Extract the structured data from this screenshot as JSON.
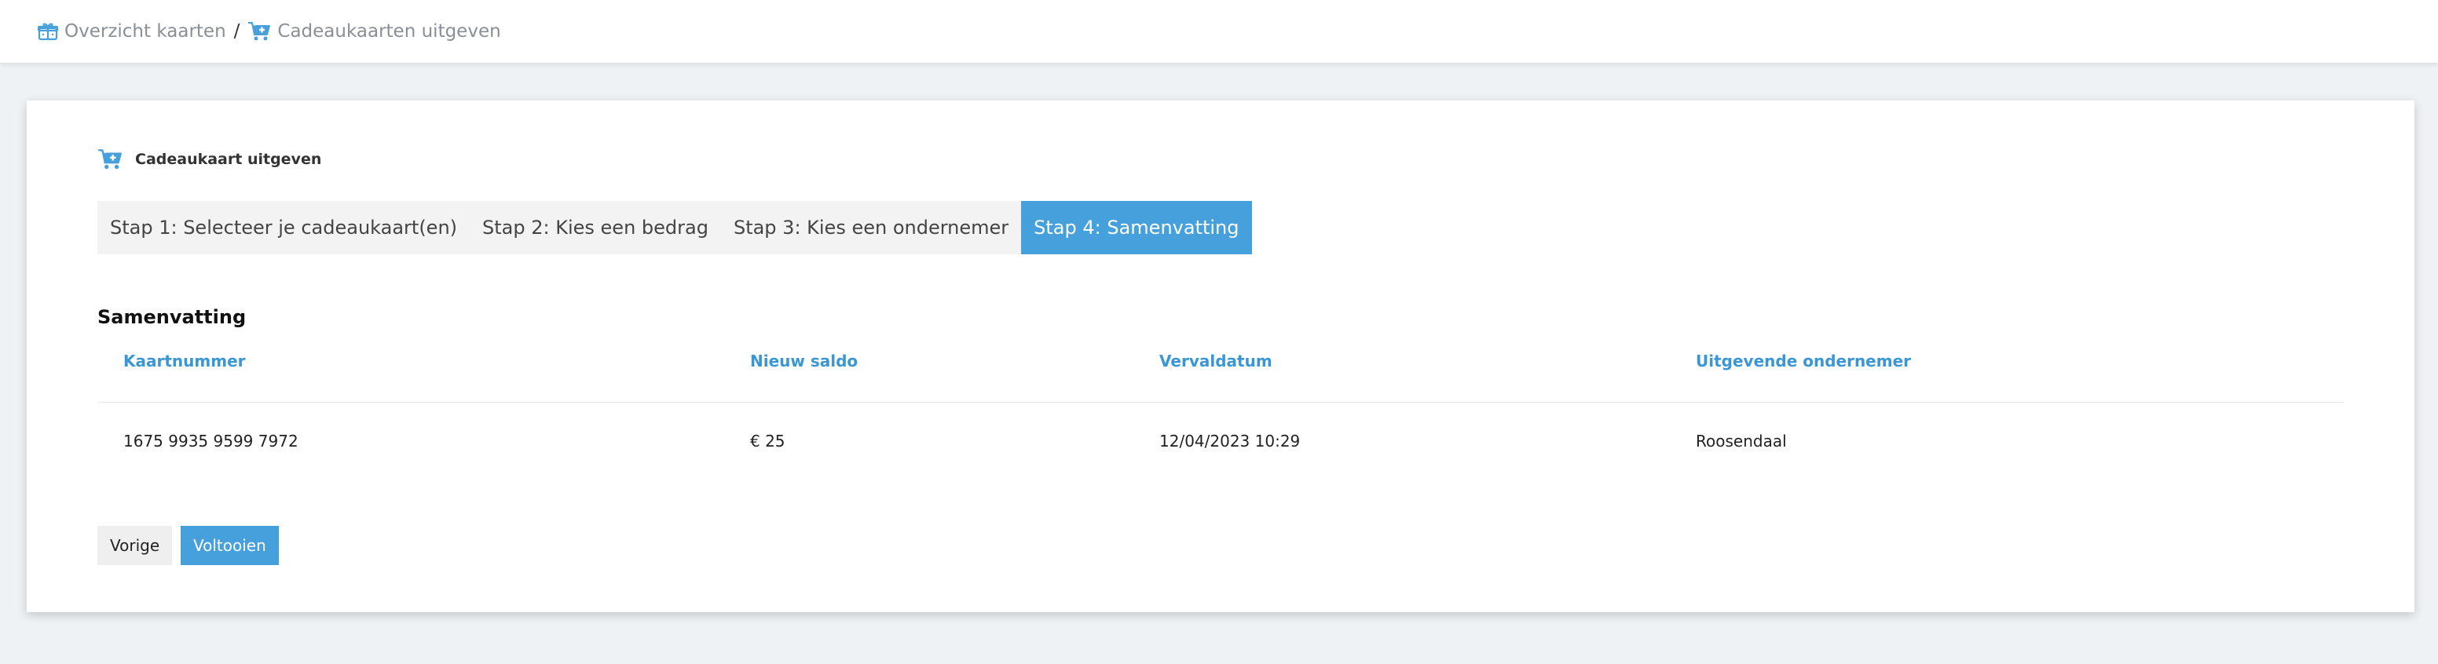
{
  "breadcrumb": {
    "items": [
      {
        "label": "Overzicht kaarten",
        "icon": "gift-box-icon"
      },
      {
        "label": "Cadeaukaarten uitgeven",
        "icon": "cart-plus-icon"
      }
    ],
    "separator": "/"
  },
  "card": {
    "title": "Cadeaukaart uitgeven",
    "icon": "cart-plus-icon"
  },
  "steps": [
    {
      "label": "Stap 1: Selecteer je cadeaukaart(en)",
      "active": false
    },
    {
      "label": "Stap 2: Kies een bedrag",
      "active": false
    },
    {
      "label": "Stap 3: Kies een ondernemer",
      "active": false
    },
    {
      "label": "Stap 4: Samenvatting",
      "active": true
    }
  ],
  "summary": {
    "title": "Samenvatting",
    "columns": [
      "Kaartnummer",
      "Nieuw saldo",
      "Vervaldatum",
      "Uitgevende ondernemer"
    ],
    "rows": [
      [
        "1675 9935 9599 7972",
        "€ 25",
        "12/04/2023 10:29",
        "Roosendaal"
      ]
    ]
  },
  "buttons": {
    "prev_label": "Vorige",
    "finish_label": "Voltooien"
  },
  "colors": {
    "accent": "#46a0dc",
    "header_text": "#3a97d6",
    "background": "#eef2f5"
  }
}
